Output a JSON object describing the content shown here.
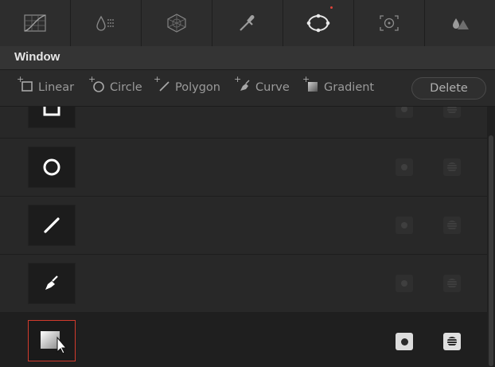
{
  "toolbar": {
    "tools": [
      {
        "icon": "curves-icon"
      },
      {
        "icon": "qualifier-icon"
      },
      {
        "icon": "color-warper-icon"
      },
      {
        "icon": "eyedropper-icon"
      },
      {
        "icon": "window-icon",
        "active": true
      },
      {
        "icon": "tracker-icon"
      },
      {
        "icon": "blur-icon"
      }
    ]
  },
  "header": {
    "title": "Window"
  },
  "shapes": {
    "linear": "Linear",
    "circle": "Circle",
    "polygon": "Polygon",
    "curve": "Curve",
    "gradient": "Gradient",
    "delete": "Delete"
  },
  "rows": [
    {
      "shape": "linear-shape-icon",
      "enabled": false
    },
    {
      "shape": "circle-shape-icon",
      "enabled": false
    },
    {
      "shape": "polygon-shape-icon",
      "enabled": false
    },
    {
      "shape": "curve-shape-icon",
      "enabled": false
    },
    {
      "shape": "gradient-shape-icon",
      "enabled": true,
      "selected": true
    }
  ],
  "colors": {
    "background": "#262626",
    "selection_border": "#d23b2d",
    "active_indicator": "#e0443a"
  }
}
